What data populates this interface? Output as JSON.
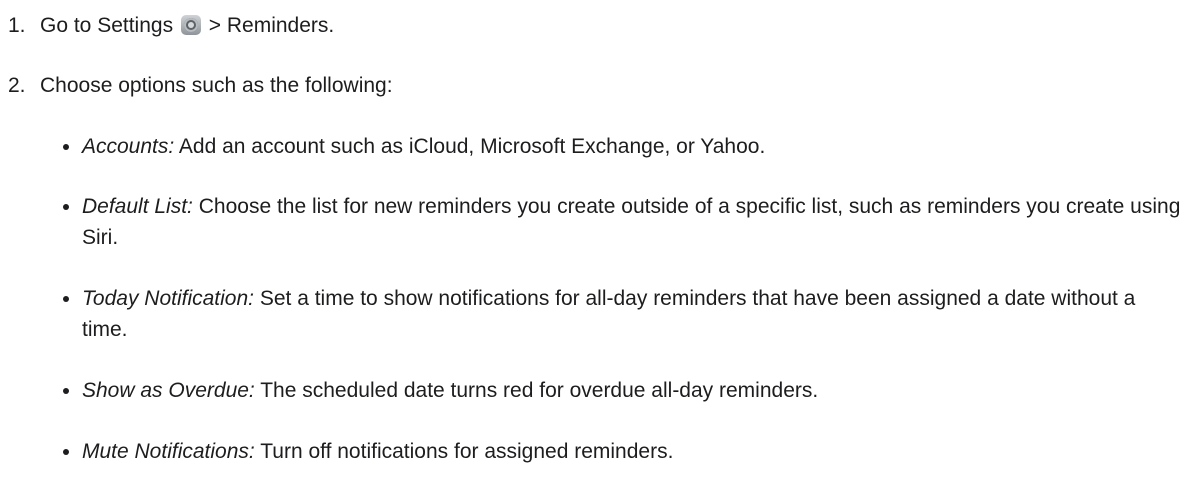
{
  "steps": [
    {
      "number": "1.",
      "text_before": "Go to Settings",
      "icon": "settings-icon",
      "text_after": "> Reminders."
    },
    {
      "number": "2.",
      "text": "Choose options such as the following:"
    }
  ],
  "options": [
    {
      "term": "Accounts:",
      "desc": "Add an account such as iCloud, Microsoft Exchange, or Yahoo."
    },
    {
      "term": "Default List:",
      "desc": "Choose the list for new reminders you create outside of a specific list, such as reminders you create using Siri."
    },
    {
      "term": "Today Notification:",
      "desc": "Set a time to show notifications for all-day reminders that have been assigned a date without a time."
    },
    {
      "term": "Show as Overdue:",
      "desc": "The scheduled date turns red for overdue all-day reminders."
    },
    {
      "term": "Mute Notifications:",
      "desc": "Turn off notifications for assigned reminders."
    }
  ]
}
